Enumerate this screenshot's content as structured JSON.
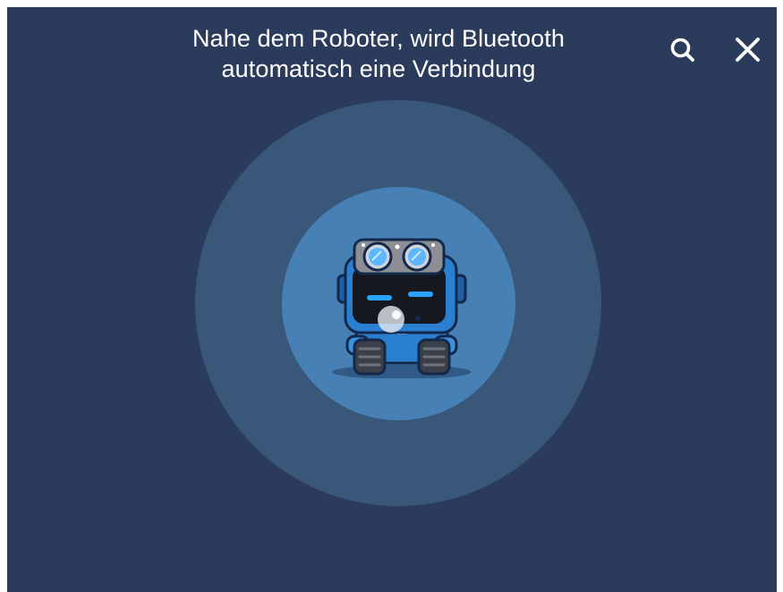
{
  "header": {
    "title_line1": "Nahe dem Roboter, wird Bluetooth",
    "title_line2": "automatisch eine Verbindung"
  },
  "icons": {
    "search": "search-icon",
    "close": "close-icon",
    "robot": "robot-illustration"
  },
  "colors": {
    "background": "#2b3b5c",
    "outer_ring": "#395779",
    "inner_ring": "#4680b4",
    "text": "#ffffff"
  }
}
